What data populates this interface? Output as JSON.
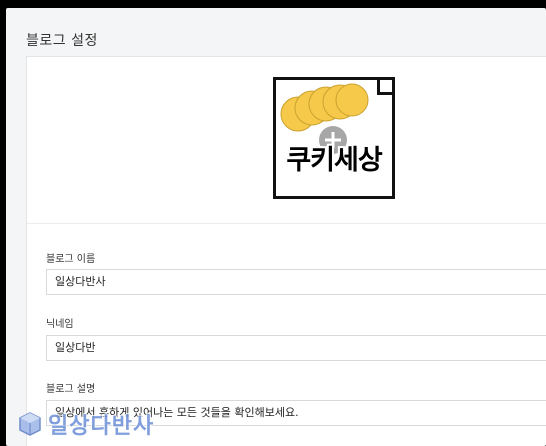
{
  "page": {
    "title": "블로그 설정"
  },
  "profile": {
    "logo_text": "쿠키세상",
    "upload_icon": "plus-icon"
  },
  "fields": [
    {
      "label": "블로그 이름",
      "value": "일상다반사"
    },
    {
      "label": "닉네임",
      "value": "일상다반"
    },
    {
      "label": "블로그 설명",
      "value": "일상에서 흔하게 있어나는 모든 것들을 확인해보세요."
    }
  ],
  "watermark": {
    "text": "일상다반사",
    "icon": "cube-logo-icon"
  },
  "colors": {
    "accent": "#6c8fd6",
    "cookie": "#f6c94a",
    "background": "#f4f5f6"
  }
}
